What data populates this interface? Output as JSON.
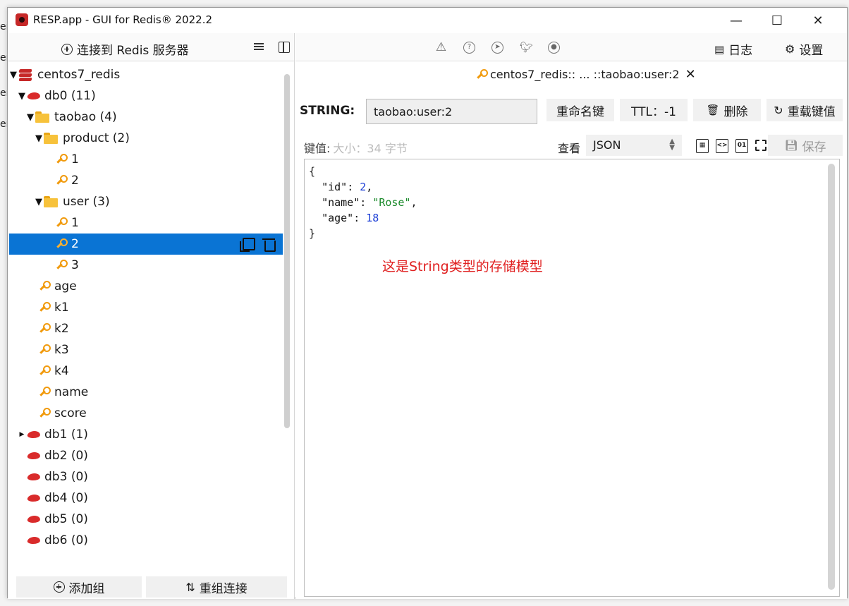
{
  "window": {
    "title": "RESP.app - GUI for Redis® 2022.2"
  },
  "left_panel": {
    "connect_label": "连接到 Redis 服务器",
    "connection": "centos7_redis",
    "db0": {
      "name": "db0",
      "count": "(11)"
    },
    "folder_taobao": {
      "name": "taobao",
      "count": "(4)"
    },
    "folder_product": {
      "name": "product",
      "count": "(2)"
    },
    "product_keys": [
      "1",
      "2"
    ],
    "folder_user": {
      "name": "user",
      "count": "(3)"
    },
    "user_keys": [
      "1",
      "2",
      "3"
    ],
    "db0_keys": [
      "age",
      "k1",
      "k2",
      "k3",
      "k4",
      "name",
      "score"
    ],
    "other_dbs": [
      {
        "name": "db1",
        "count": "(1)"
      },
      {
        "name": "db2",
        "count": "(0)"
      },
      {
        "name": "db3",
        "count": "(0)"
      },
      {
        "name": "db4",
        "count": "(0)"
      },
      {
        "name": "db5",
        "count": "(0)"
      },
      {
        "name": "db6",
        "count": "(0)"
      }
    ],
    "add_group_label": "添加组",
    "reorg_label": "重组连接"
  },
  "toolbar": {
    "log_label": "日志",
    "settings_label": "设置"
  },
  "tab": {
    "label": "centos7_redis:: ... ::taobao:user:2"
  },
  "key_panel": {
    "type": "STRING:",
    "key_name": "taobao:user:2",
    "rename_label": "重命名键",
    "ttl_label": "TTL：-1",
    "delete_label": "删除",
    "reload_label": "重载键值"
  },
  "value_panel": {
    "value_label": "键值:",
    "size_text": "大小：34 字节",
    "view_label": "查看",
    "format": "JSON",
    "save_label": "保存"
  },
  "editor": {
    "open_brace": "{",
    "id_key": "\"id\"",
    "id_val": "2",
    "name_key": "\"name\"",
    "name_val": "\"Rose\"",
    "age_key": "\"age\"",
    "age_val": "18",
    "close_brace": "}",
    "annotation": "这是String类型的存储模型"
  },
  "colors": {
    "selected_row": "#0a74d4",
    "annotation": "#e02020",
    "redis_red": "#d92b2b"
  }
}
